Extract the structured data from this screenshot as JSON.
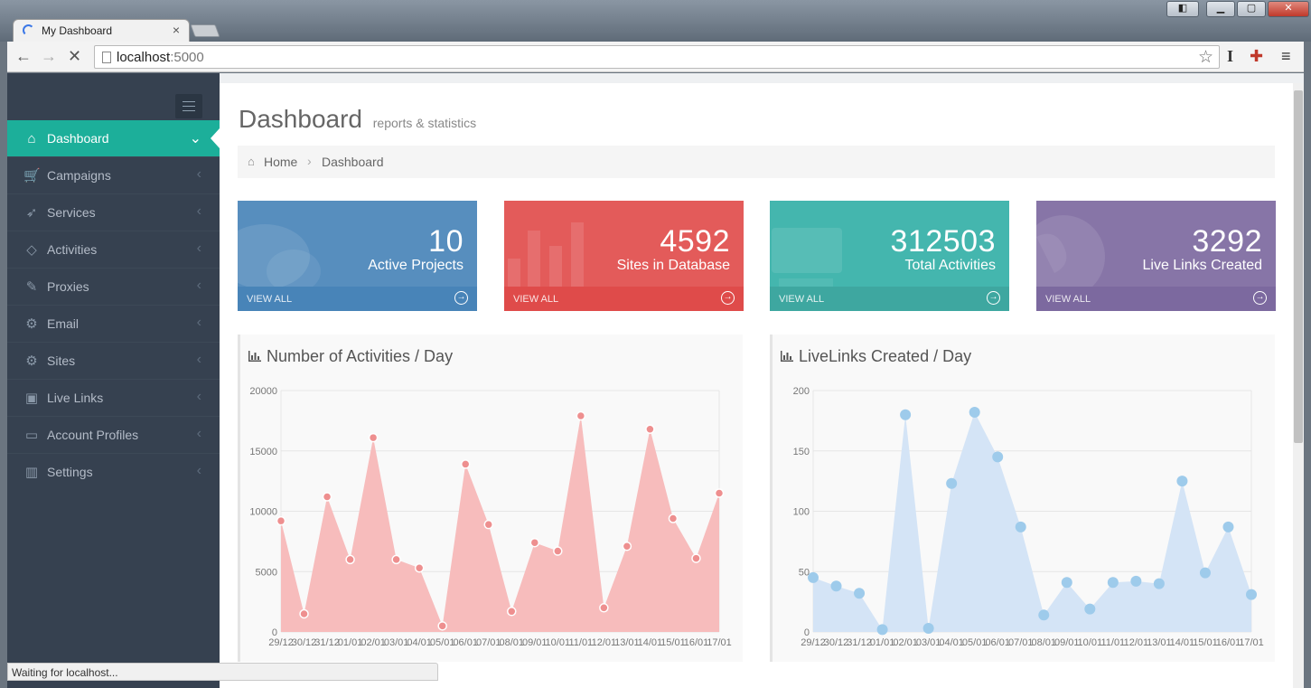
{
  "browser": {
    "tab_title": "My Dashboard",
    "url_host": "localhost",
    "url_port": ":5000",
    "status_text": "Waiting for localhost..."
  },
  "sidebar": {
    "items": [
      {
        "label": "Dashboard",
        "icon": "home-icon",
        "glyph": "⌂",
        "active": true
      },
      {
        "label": "Campaigns",
        "icon": "basket-icon",
        "glyph": "🛒"
      },
      {
        "label": "Services",
        "icon": "rocket-icon",
        "glyph": "➶"
      },
      {
        "label": "Activities",
        "icon": "diamond-icon",
        "glyph": "◇"
      },
      {
        "label": "Proxies",
        "icon": "pencil-icon",
        "glyph": "✎"
      },
      {
        "label": "Email",
        "icon": "gear-icon",
        "glyph": "⚙"
      },
      {
        "label": "Sites",
        "icon": "gear-icon",
        "glyph": "⚙"
      },
      {
        "label": "Live Links",
        "icon": "briefcase-icon",
        "glyph": "▣"
      },
      {
        "label": "Account Profiles",
        "icon": "folder-icon",
        "glyph": "▭"
      },
      {
        "label": "Settings",
        "icon": "bar-chart-icon",
        "glyph": "▥"
      }
    ]
  },
  "page": {
    "title": "Dashboard",
    "subtitle": "reports & statistics"
  },
  "breadcrumb": {
    "home": "Home",
    "current": "Dashboard"
  },
  "stats": [
    {
      "number": "10",
      "label": "Active Projects",
      "link": "VIEW ALL",
      "color": "#578ebe",
      "footer_color": "#4884b8",
      "icon": "comments-icon"
    },
    {
      "number": "4592",
      "label": "Sites in Database",
      "link": "VIEW ALL",
      "color": "#e35b5a",
      "footer_color": "#df4b4a",
      "icon": "bar-chart-icon"
    },
    {
      "number": "312503",
      "label": "Total Activities",
      "link": "VIEW ALL",
      "color": "#44b6ae",
      "footer_color": "#3ea7a0",
      "icon": "shopping-cart-icon"
    },
    {
      "number": "3292",
      "label": "Live Links Created",
      "link": "VIEW ALL",
      "color": "#8775a7",
      "footer_color": "#7c699f",
      "icon": "globe-icon"
    }
  ],
  "charts": {
    "activities_title": "Number of Activities / Day",
    "livelinks_title": "LiveLinks Created / Day"
  },
  "chart_data": [
    {
      "type": "area",
      "title": "Number of Activities / Day",
      "categories": [
        "29/12",
        "30/12",
        "31/12",
        "01/01",
        "02/01",
        "03/01",
        "04/01",
        "05/01",
        "06/01",
        "07/01",
        "08/01",
        "09/01",
        "10/01",
        "11/01",
        "12/01",
        "13/01",
        "14/01",
        "15/01",
        "16/01",
        "17/01"
      ],
      "values": [
        9200,
        1500,
        11200,
        6000,
        16100,
        6000,
        5300,
        500,
        13900,
        8900,
        1700,
        7400,
        6700,
        17900,
        2000,
        7100,
        16800,
        9400,
        6100,
        11500
      ],
      "yticks": [
        0,
        5000,
        10000,
        15000,
        20000
      ],
      "ylim": [
        0,
        20000
      ],
      "color": "#f7bcbc",
      "point_color": "#ee8f8f",
      "grid": true
    },
    {
      "type": "area",
      "title": "LiveLinks Created / Day",
      "categories": [
        "29/12",
        "30/12",
        "31/12",
        "01/01",
        "02/01",
        "03/01",
        "04/01",
        "05/01",
        "06/01",
        "07/01",
        "08/01",
        "09/01",
        "10/01",
        "11/01",
        "12/01",
        "13/01",
        "14/01",
        "15/01",
        "16/01",
        "17/01"
      ],
      "values": [
        45,
        38,
        32,
        2,
        180,
        3,
        123,
        182,
        145,
        87,
        14,
        41,
        19,
        41,
        42,
        40,
        125,
        49,
        87,
        31
      ],
      "yticks": [
        0,
        50,
        100,
        150,
        200
      ],
      "ylim": [
        0,
        200
      ],
      "color": "#d4e4f6",
      "point_color": "#9ecbeb",
      "grid": true
    }
  ]
}
